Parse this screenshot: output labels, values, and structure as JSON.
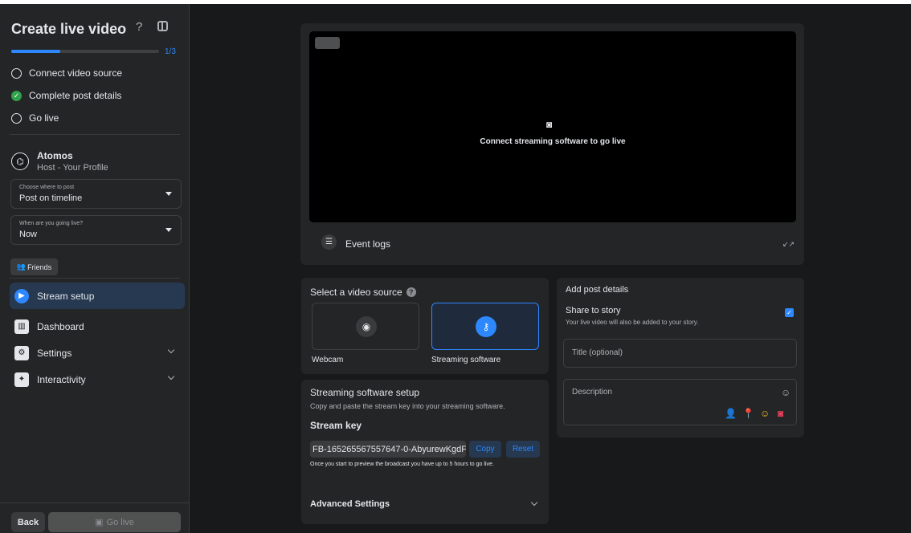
{
  "sidebar": {
    "title": "Create live video",
    "help_icon": "question-icon",
    "progress": {
      "fraction": 0.33,
      "label": "1/3"
    },
    "steps": [
      {
        "label": "Connect video source",
        "done": false
      },
      {
        "label": "Complete post details",
        "done": true
      },
      {
        "label": "Go live",
        "done": false
      }
    ],
    "profile": {
      "name": "Atomos",
      "role": "Host - Your Profile"
    },
    "post_where": {
      "label": "Choose where to post",
      "value": "Post on timeline"
    },
    "go_live_when": {
      "label": "When are you going live?",
      "value": "Now"
    },
    "audience_button": "Friends",
    "nav": [
      {
        "label": "Stream setup",
        "active": true,
        "icon": "camera-icon"
      },
      {
        "label": "Dashboard",
        "active": false,
        "icon": "dashboard-icon"
      },
      {
        "label": "Settings",
        "active": false,
        "icon": "gear-icon"
      },
      {
        "label": "Interactivity",
        "active": false,
        "icon": "sparkle-icon"
      }
    ],
    "back_label": "Back",
    "go_live_label": "Go live"
  },
  "preview": {
    "message": "Connect streaming software to go live",
    "event_logs_label": "Event logs"
  },
  "video_source": {
    "title": "Select a video source",
    "options": [
      {
        "label": "Webcam",
        "selected": false,
        "icon": "camera-icon"
      },
      {
        "label": "Streaming software",
        "selected": true,
        "icon": "key-icon"
      }
    ]
  },
  "software_setup": {
    "title": "Streaming software setup",
    "description": "Copy and paste the stream key into your streaming software.",
    "stream_key_label": "Stream key",
    "stream_key_value": "FB-165265567557647-0-AbyurewKgdF",
    "copy_label": "Copy",
    "reset_label": "Reset",
    "note": "Once you start to preview the broadcast you have up to 5 hours to go live.",
    "advanced_label": "Advanced Settings"
  },
  "post_details": {
    "title": "Add post details",
    "share_story_label": "Share to story",
    "share_story_sub": "Your live video will also be added to your story.",
    "share_story_checked": true,
    "title_placeholder": "Title (optional)",
    "description_placeholder": "Description"
  },
  "colors": {
    "accent": "#2d88ff",
    "success": "#31a24c",
    "background": "#18191a",
    "card": "#242526"
  }
}
